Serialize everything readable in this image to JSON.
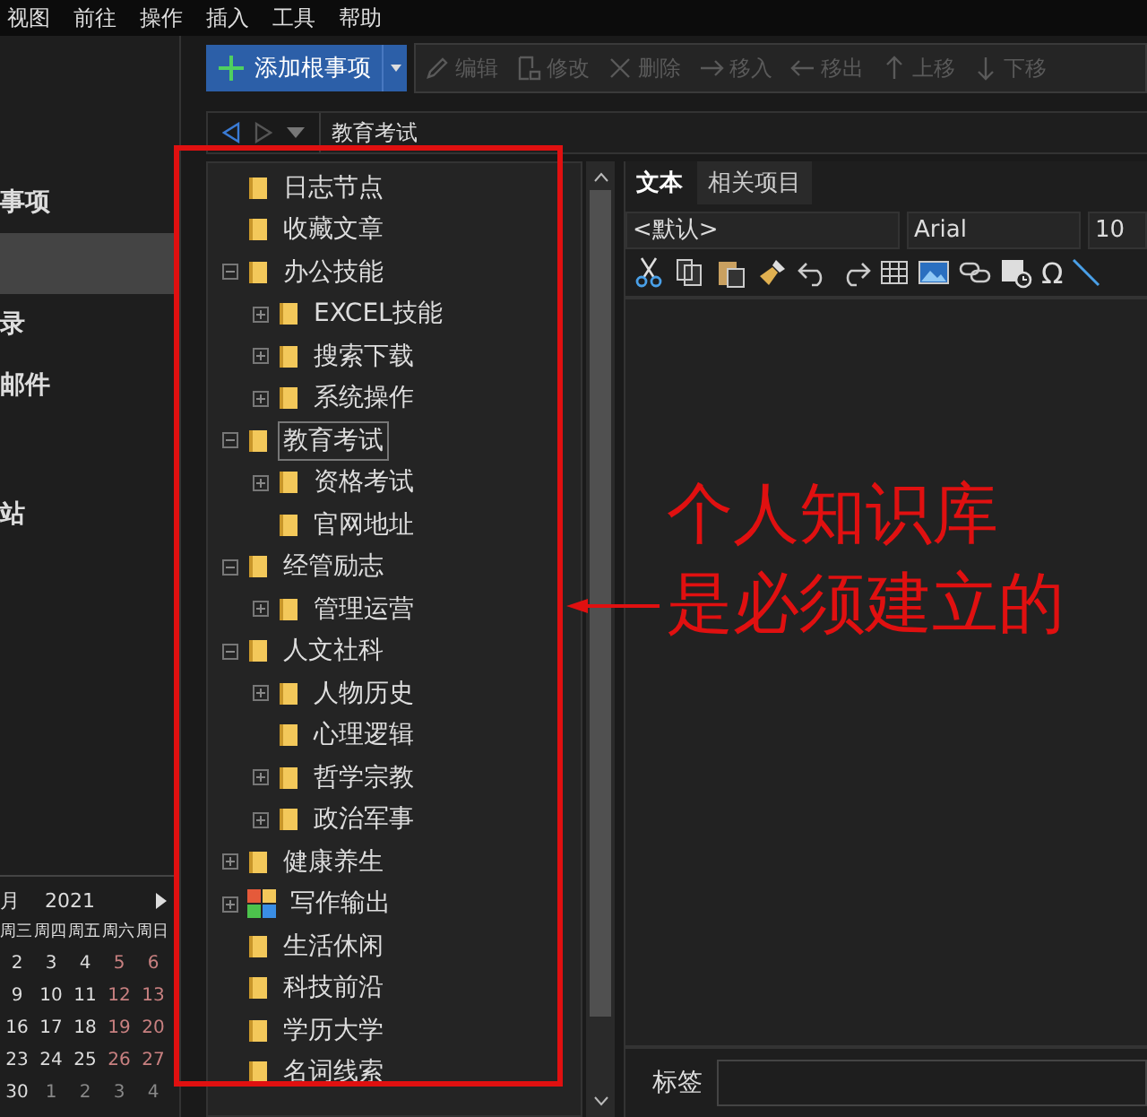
{
  "menu": [
    "视图",
    "前往",
    "操作",
    "插入",
    "工具",
    "帮助"
  ],
  "sidebar": {
    "items": [
      {
        "label": "事项",
        "selected": false
      },
      {
        "selected": true
      },
      {
        "label": "录",
        "selected": false
      },
      {
        "label": "邮件",
        "selected": false
      },
      {
        "label": "站",
        "selected": false
      }
    ]
  },
  "calendar": {
    "month": "月",
    "year": "2021",
    "weekdays": [
      "周三",
      "周四",
      "周五",
      "周六",
      "周日"
    ],
    "days": [
      {
        "text": "2",
        "kind": "normal"
      },
      {
        "text": "3",
        "kind": "normal"
      },
      {
        "text": "4",
        "kind": "normal"
      },
      {
        "text": "5",
        "kind": "weekend"
      },
      {
        "text": "6",
        "kind": "weekend"
      },
      {
        "text": "9",
        "kind": "normal"
      },
      {
        "text": "10",
        "kind": "normal"
      },
      {
        "text": "11",
        "kind": "normal"
      },
      {
        "text": "12",
        "kind": "weekend"
      },
      {
        "text": "13",
        "kind": "weekend"
      },
      {
        "text": "16",
        "kind": "normal"
      },
      {
        "text": "17",
        "kind": "normal"
      },
      {
        "text": "18",
        "kind": "normal"
      },
      {
        "text": "19",
        "kind": "weekend"
      },
      {
        "text": "20",
        "kind": "weekend"
      },
      {
        "text": "23",
        "kind": "normal"
      },
      {
        "text": "24",
        "kind": "normal"
      },
      {
        "text": "25",
        "kind": "normal"
      },
      {
        "text": "26",
        "kind": "weekend"
      },
      {
        "text": "27",
        "kind": "weekend"
      },
      {
        "text": "30",
        "kind": "normal"
      },
      {
        "text": "1",
        "kind": "other"
      },
      {
        "text": "2",
        "kind": "other"
      },
      {
        "text": "3",
        "kind": "other"
      },
      {
        "text": "4",
        "kind": "other"
      }
    ]
  },
  "toolbar": {
    "add_button": "添加根事项",
    "buttons": [
      {
        "label": "编辑",
        "kind": "pencil",
        "disabled": true
      },
      {
        "label": "修改",
        "kind": "edit",
        "disabled": true
      },
      {
        "label": "删除",
        "kind": "delete",
        "disabled": true
      },
      {
        "label": "移入",
        "kind": "in",
        "disabled": true
      },
      {
        "label": "移出",
        "kind": "out",
        "disabled": true
      },
      {
        "label": "上移",
        "kind": "up",
        "disabled": true
      },
      {
        "label": "下移",
        "kind": "down",
        "disabled": true
      }
    ]
  },
  "nav": {
    "path": "教育考试"
  },
  "tree": {
    "items": [
      {
        "label": "日志节点",
        "kind": "folder",
        "selected": false
      },
      {
        "label": "收藏文章",
        "kind": "folder",
        "selected": false
      },
      {
        "label": "办公技能",
        "kind": "folder",
        "selected": false,
        "expanded": true,
        "children": [
          {
            "label": "EXCEL技能",
            "kind": "folder",
            "selected": false,
            "expanded": false
          },
          {
            "label": "搜索下载",
            "kind": "folder",
            "selected": false,
            "expanded": false
          },
          {
            "label": "系统操作",
            "kind": "folder",
            "selected": false,
            "expanded": false
          }
        ]
      },
      {
        "label": "教育考试",
        "kind": "folder",
        "selected": true,
        "expanded": true,
        "children": [
          {
            "label": "资格考试",
            "kind": "folder",
            "selected": false,
            "expanded": false
          },
          {
            "label": "官网地址",
            "kind": "folder",
            "selected": false
          }
        ]
      },
      {
        "label": "经管励志",
        "kind": "folder",
        "selected": false,
        "expanded": true,
        "children": [
          {
            "label": "管理运营",
            "kind": "folder",
            "selected": false,
            "expanded": false
          }
        ]
      },
      {
        "label": "人文社科",
        "kind": "folder",
        "selected": false,
        "expanded": true,
        "children": [
          {
            "label": "人物历史",
            "kind": "folder",
            "selected": false,
            "expanded": false
          },
          {
            "label": "心理逻辑",
            "kind": "folder",
            "selected": false
          },
          {
            "label": "哲学宗教",
            "kind": "folder",
            "selected": false,
            "expanded": false
          },
          {
            "label": "政治军事",
            "kind": "folder",
            "selected": false,
            "expanded": false
          }
        ]
      },
      {
        "label": "健康养生",
        "kind": "folder",
        "selected": false,
        "expanded": false
      },
      {
        "label": "写作输出",
        "kind": "tiles",
        "selected": false,
        "expanded": false
      },
      {
        "label": "生活休闲",
        "kind": "folder",
        "selected": false
      },
      {
        "label": "科技前沿",
        "kind": "folder",
        "selected": false
      },
      {
        "label": "学历大学",
        "kind": "folder",
        "selected": false
      },
      {
        "label": "名词线索",
        "kind": "folder",
        "selected": false
      }
    ]
  },
  "editor": {
    "tabs": [
      {
        "label": "文本",
        "selected": true
      },
      {
        "label": "相关项目",
        "selected": false
      }
    ],
    "style": "<默认>",
    "font": "Arial",
    "size": "10",
    "symbol": "Ω",
    "tag_label": "标签"
  },
  "annotation": {
    "lines": [
      "个人知识库",
      "是必须建立的"
    ]
  }
}
